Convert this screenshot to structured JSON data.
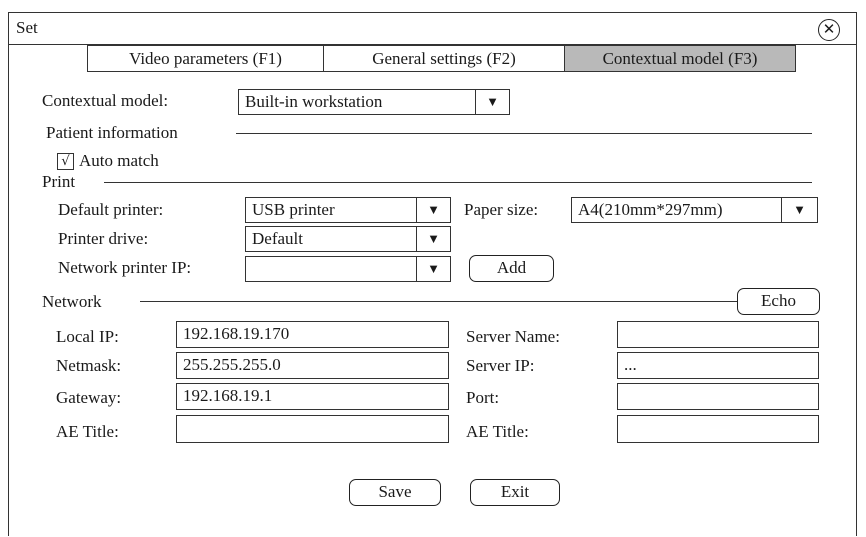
{
  "window": {
    "title": "Set"
  },
  "tabs": [
    {
      "label": "Video parameters (F1)"
    },
    {
      "label": "General settings (F2)"
    },
    {
      "label": "Contextual model (F3)"
    }
  ],
  "contextual": {
    "label": "Contextual model:",
    "value": "Built-in workstation"
  },
  "patient": {
    "section": "Patient information",
    "auto_match_label": "Auto match",
    "auto_match_checked": "√"
  },
  "print": {
    "section": "Print",
    "default_printer_label": "Default printer:",
    "default_printer_value": "USB printer",
    "printer_drive_label": "Printer drive:",
    "printer_drive_value": "Default",
    "network_ip_label": "Network printer IP:",
    "network_ip_value": "",
    "paper_size_label": "Paper size:",
    "paper_size_value": "A4(210mm*297mm)",
    "add_label": "Add"
  },
  "network": {
    "section": "Network",
    "echo_label": "Echo",
    "local_ip_label": "Local IP:",
    "local_ip_value": "192.168.19.170",
    "netmask_label": "Netmask:",
    "netmask_value": "255.255.255.0",
    "gateway_label": "Gateway:",
    "gateway_value": "192.168.19.1",
    "ae_title_label": "AE Title:",
    "ae_title_value": "",
    "server_name_label": "Server Name:",
    "server_name_value": "",
    "server_ip_label": "Server IP:",
    "server_ip_value": "...",
    "port_label": "Port:",
    "port_value": "",
    "server_ae_title_label": "AE Title:",
    "server_ae_title_value": ""
  },
  "actions": {
    "save_label": "Save",
    "exit_label": "Exit"
  },
  "icons": {
    "close": "close-icon",
    "dropdown": "dropdown-arrow-icon"
  },
  "dropdown_glyph": "▼",
  "close_glyph": "✕"
}
